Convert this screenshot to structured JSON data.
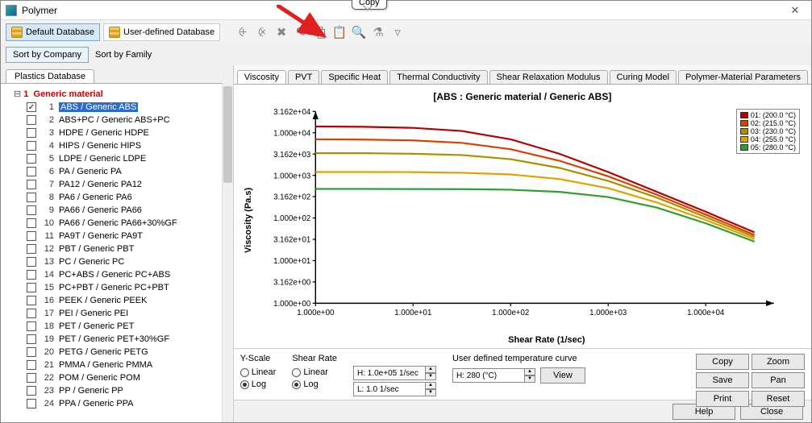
{
  "window": {
    "title": "Polymer"
  },
  "callout": "Copy",
  "toolbar1": {
    "default_db": "Default Database",
    "user_db": "User-defined Database"
  },
  "toolbar2": {
    "sort_company": "Sort by Company",
    "sort_family": "Sort by Family"
  },
  "left_tab": "Plastics Database",
  "tree": {
    "category_num": "1",
    "category": "Generic material",
    "items": [
      "ABS / Generic ABS",
      "ABS+PC / Generic ABS+PC",
      "HDPE / Generic HDPE",
      "HIPS / Generic HIPS",
      "LDPE / Generic LDPE",
      "PA / Generic PA",
      "PA12 / Generic PA12",
      "PA6 / Generic PA6",
      "PA66 / Generic PA66",
      "PA66 / Generic PA66+30%GF",
      "PA9T / Generic PA9T",
      "PBT / Generic PBT",
      "PC / Generic PC",
      "PC+ABS / Generic PC+ABS",
      "PC+PBT / Generic PC+PBT",
      "PEEK / Generic PEEK",
      "PEI / Generic PEI",
      "PET / Generic PET",
      "PET / Generic PET+30%GF",
      "PETG / Generic PETG",
      "PMMA / Generic PMMA",
      "POM / Generic POM",
      "PP / Generic PP",
      "PPA / Generic PPA"
    ]
  },
  "right_tabs": [
    "Viscosity",
    "PVT",
    "Specific Heat",
    "Thermal Conductivity",
    "Shear Relaxation Modulus",
    "Curing Model",
    "Polymer-Material Parameters"
  ],
  "chart": {
    "title": "[ABS : Generic material / Generic ABS]",
    "ylabel": "Viscosity (Pa.s)",
    "xlabel": "Shear Rate (1/sec)",
    "yticks": [
      "3.162e+04",
      "1.000e+04",
      "3.162e+03",
      "1.000e+03",
      "3.162e+02",
      "1.000e+02",
      "3.162e+01",
      "1.000e+01",
      "3.162e+00",
      "1.000e+00"
    ],
    "xticks": [
      "1.000e+00",
      "1.000e+01",
      "1.000e+02",
      "1.000e+03",
      "1.000e+04"
    ],
    "legend": [
      {
        "label": "01: (200.0 °C)",
        "color": "#b30000"
      },
      {
        "label": "02: (215.0 °C)",
        "color": "#d94000"
      },
      {
        "label": "03: (230.0 °C)",
        "color": "#a89000"
      },
      {
        "label": "04: (255.0 °C)",
        "color": "#e0a000"
      },
      {
        "label": "05: (280.0 °C)",
        "color": "#2f9e2f"
      }
    ]
  },
  "chart_data": {
    "type": "line",
    "title": "[ABS : Generic material / Generic ABS]",
    "xlabel": "Shear Rate (1/sec)",
    "ylabel": "Viscosity (Pa.s)",
    "x_scale": "log",
    "y_scale": "log",
    "xlim": [
      1,
      50000
    ],
    "ylim": [
      1,
      31620
    ],
    "x": [
      1,
      3.162,
      10,
      31.62,
      100,
      316.2,
      1000,
      3162,
      10000,
      31620
    ],
    "series": [
      {
        "name": "01: (200.0 °C)",
        "color": "#b30000",
        "values": [
          14000,
          13800,
          13000,
          11000,
          7000,
          3200,
          1200,
          410,
          140,
          46
        ]
      },
      {
        "name": "02: (215.0 °C)",
        "color": "#d94000",
        "values": [
          7000,
          6900,
          6600,
          5800,
          4100,
          2200,
          950,
          350,
          120,
          40
        ]
      },
      {
        "name": "03: (230.0 °C)",
        "color": "#a89000",
        "values": [
          3300,
          3300,
          3200,
          3000,
          2400,
          1500,
          740,
          300,
          105,
          36
        ]
      },
      {
        "name": "04: (255.0 °C)",
        "color": "#e0a000",
        "values": [
          1200,
          1200,
          1190,
          1150,
          1050,
          820,
          500,
          230,
          90,
          32
        ]
      },
      {
        "name": "05: (280.0 °C)",
        "color": "#2f9e2f",
        "values": [
          480,
          480,
          478,
          475,
          460,
          410,
          310,
          175,
          75,
          28
        ]
      }
    ]
  },
  "controls": {
    "yscale_label": "Y-Scale",
    "shear_label": "Shear Rate",
    "temp_label": "User defined temperature curve",
    "linear": "Linear",
    "log": "Log",
    "shear_hi": "H: 1.0e+05 1/sec",
    "shear_lo": "L: 1.0 1/sec",
    "temp_val": "H: 280 (°C)",
    "view": "View",
    "btns": {
      "copy": "Copy",
      "zoom": "Zoom",
      "save": "Save",
      "pan": "Pan",
      "print": "Print",
      "reset": "Reset"
    }
  },
  "footer": {
    "help": "Help",
    "close": "Close"
  }
}
